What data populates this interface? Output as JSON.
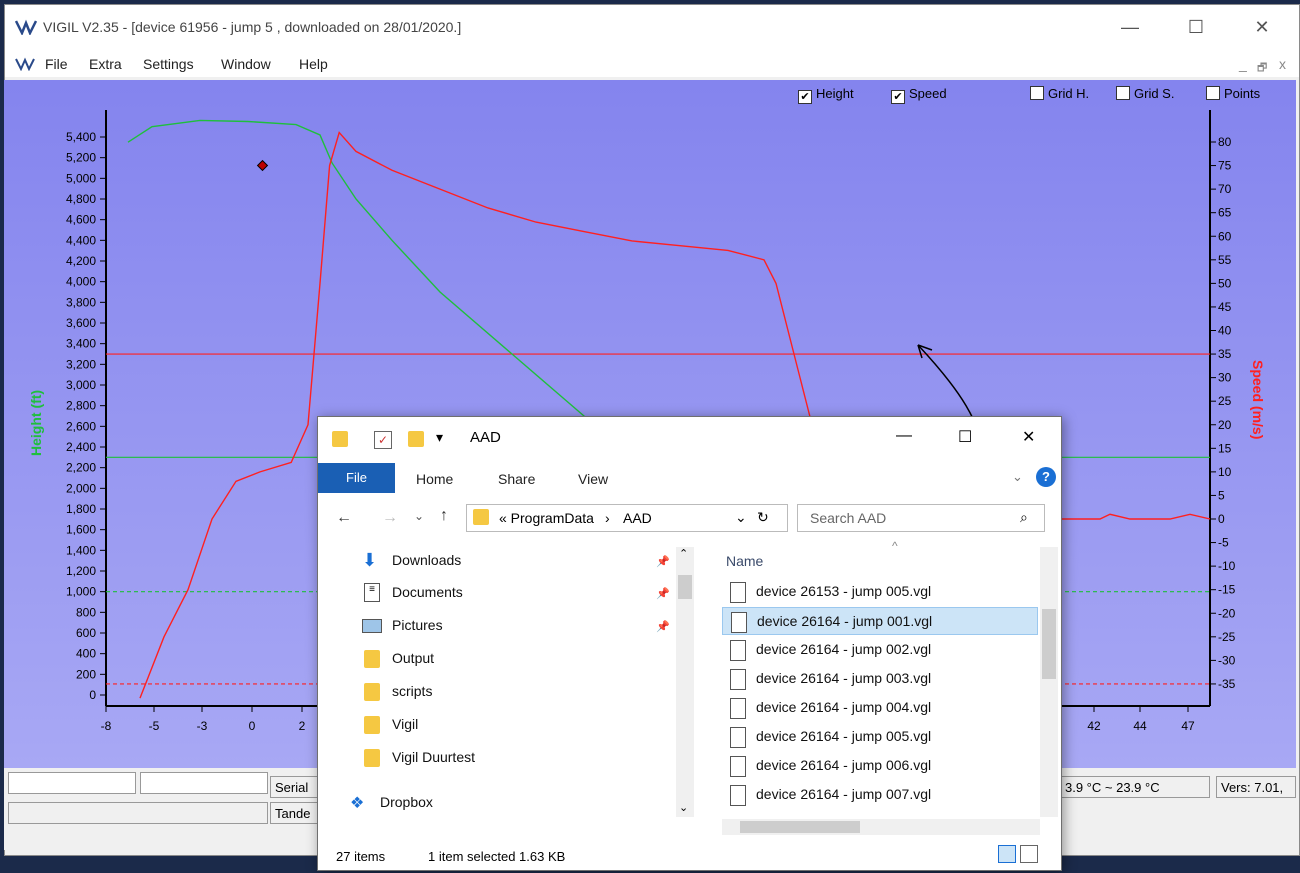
{
  "window": {
    "title": "VIGIL  V2.35 - [device 61956 - jump 5  ,  downloaded  on  28/01/2020.]",
    "minimize": "—",
    "maximize": "☐",
    "close": "✕"
  },
  "menu": [
    "File",
    "Extra",
    "Settings",
    "Window",
    "Help"
  ],
  "mdi_controls": [
    "_",
    "🗗",
    "x"
  ],
  "toggles": [
    {
      "label": "Height",
      "checked": true
    },
    {
      "label": "Speed",
      "checked": true
    },
    {
      "label": "Grid H.",
      "checked": false
    },
    {
      "label": "Grid S.",
      "checked": false
    },
    {
      "label": "Points",
      "checked": false
    }
  ],
  "chart_data": {
    "type": "line",
    "ylabel": "Height (ft)",
    "y2label": "Speed (m/s)",
    "y_ticks": [
      "5,400",
      "5,200",
      "5,000",
      "4,800",
      "4,600",
      "4,400",
      "4,200",
      "4,000",
      "3,800",
      "3,600",
      "3,400",
      "3,200",
      "3,000",
      "2,800",
      "2,600",
      "2,400",
      "2,200",
      "2,000",
      "1,800",
      "1,600",
      "1,400",
      "1,200",
      "1,000",
      "800",
      "600",
      "400",
      "200",
      "0"
    ],
    "y2_ticks": [
      "80",
      "75",
      "70",
      "65",
      "60",
      "55",
      "50",
      "45",
      "40",
      "35",
      "30",
      "25",
      "20",
      "15",
      "10",
      "5",
      "0",
      "-5",
      "-10",
      "-15",
      "-20",
      "-25",
      "-30",
      "-35"
    ],
    "x_ticks": [
      "-8",
      "-5",
      "-3",
      "0",
      "2",
      "42",
      "44",
      "47"
    ],
    "series": [
      {
        "name": "Height",
        "color": "#1fbf3c",
        "x": [
          -8.0,
          -7.0,
          -5.0,
          -3.0,
          -1.0,
          0.0,
          0.5,
          1.5,
          3.0,
          5.0,
          8.0,
          11.0,
          14.0
        ],
        "y": [
          5350,
          5500,
          5560,
          5550,
          5520,
          5420,
          5150,
          4800,
          4400,
          3900,
          3300,
          2700,
          2150
        ]
      },
      {
        "name": "Speed",
        "color": "#ff2020",
        "x": [
          -7.5,
          -6.5,
          -5.5,
          -4.5,
          -3.5,
          -2.5,
          -1.2,
          -0.5,
          0.0,
          0.4,
          0.8,
          1.5,
          3.0,
          5.0,
          7.0,
          9.0,
          11.0,
          13.0,
          15.0,
          17.0,
          18.5,
          19.0,
          20.0,
          20.5
        ],
        "y": [
          -38,
          -25,
          -15,
          0,
          8,
          10,
          12,
          20,
          50,
          75,
          82,
          78,
          74,
          70,
          66,
          63,
          61,
          59,
          58,
          57,
          55,
          50,
          30,
          20
        ]
      }
    ],
    "ref_lines": [
      {
        "axis": "speed",
        "value": 35,
        "color": "#ff2020"
      },
      {
        "axis": "height",
        "value": 2300,
        "color": "#1fbf3c"
      },
      {
        "axis": "height",
        "value": 1000,
        "color": "#1fbf3c",
        "dashed": true
      },
      {
        "axis": "speed",
        "value": -35,
        "color": "#ff2020",
        "dashed": true
      }
    ],
    "right_tail": {
      "x": [
        41.0,
        47.5
      ],
      "y": [
        0,
        1
      ]
    }
  },
  "status": {
    "serial": "Serial",
    "tande": "Tande",
    "temperature": "3.9 °C ~  23.9 °C",
    "version": "Vers: 7.01,"
  },
  "explorer": {
    "title": "AAD",
    "tabs": [
      "Home",
      "Share",
      "View"
    ],
    "file_tab": "File",
    "path": [
      "« ProgramData",
      "AAD"
    ],
    "search_placeholder": "Search AAD",
    "nav": [
      "Downloads",
      "Documents",
      "Pictures",
      "Output",
      "scripts",
      "Vigil",
      "Vigil Duurtest",
      "Dropbox"
    ],
    "column_header": "Name",
    "files": [
      "device 26153 - jump 005.vgl",
      "device 26164 - jump 001.vgl",
      "device 26164 - jump 002.vgl",
      "device 26164 - jump 003.vgl",
      "device 26164 - jump 004.vgl",
      "device 26164 - jump 005.vgl",
      "device 26164 - jump 006.vgl",
      "device 26164 - jump 007.vgl"
    ],
    "selected_index": 1,
    "item_count": "27 items",
    "selection": "1 item selected  1.63 KB"
  }
}
